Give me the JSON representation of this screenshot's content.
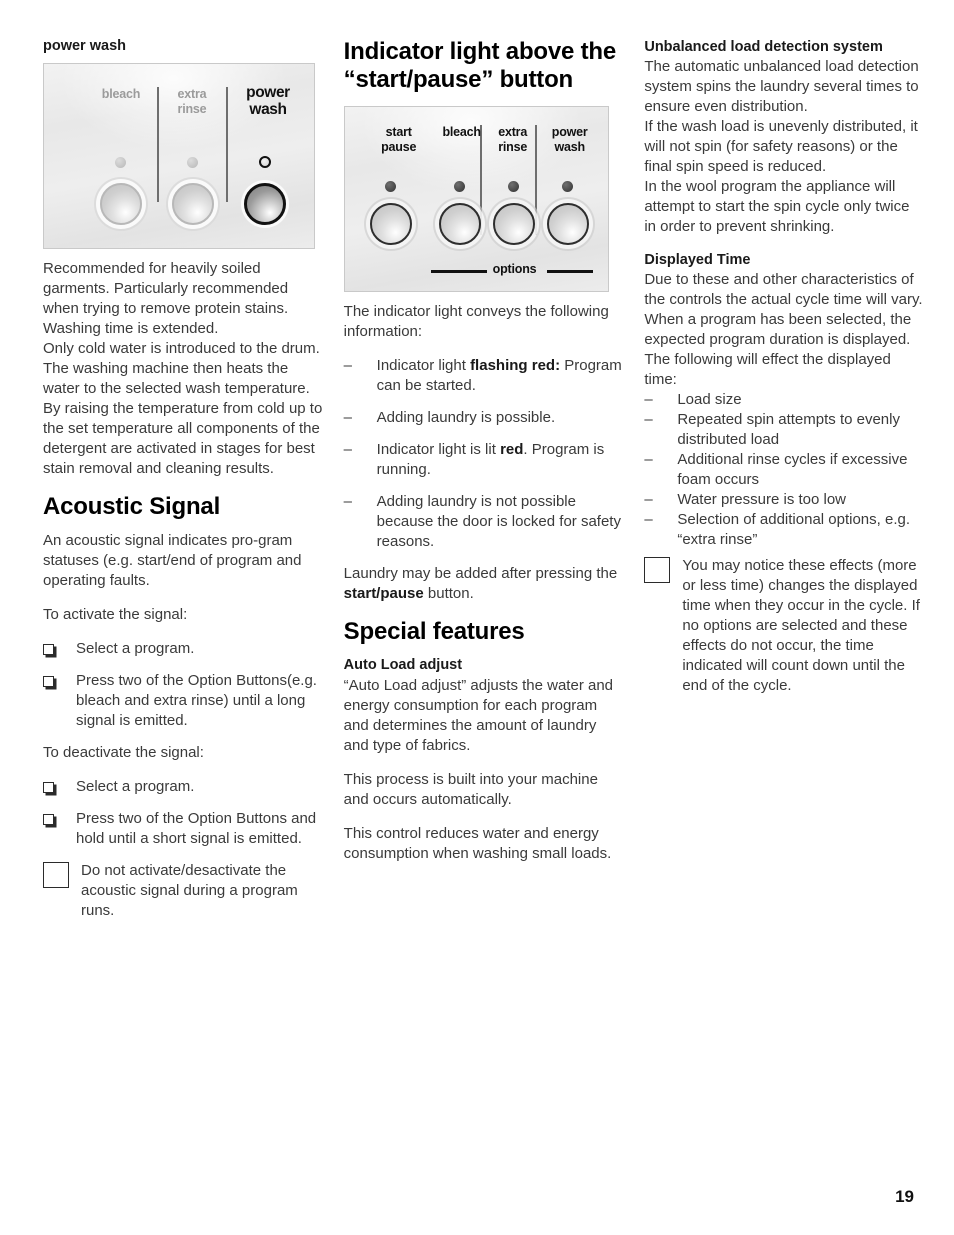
{
  "page": {
    "number": "19"
  },
  "column1": {
    "caption": "power wash",
    "figure": {
      "name": "power-wash-options-panel",
      "labels": [
        {
          "id": "bleach",
          "text": "bleach",
          "state": "dim"
        },
        {
          "id": "extra-rinse",
          "line1": "extra",
          "line2": "rinse",
          "state": "dim"
        },
        {
          "id": "power-wash",
          "line1": "power",
          "line2": "wash",
          "state": "active"
        }
      ]
    },
    "body1": "Recommended for heavily soiled garments. Particularly recommended when trying to remove protein stains.",
    "body2": "Washing time is extended.",
    "body3": "Only cold water is introduced to the drum. The washing machine then heats the water to the selected wash temperature. By raising the temperature  from cold up to the set temperature all components of the detergent are activated in stages for best stain removal and cleaning results.",
    "heading": "Acoustic Signal",
    "intro": "An acoustic signal indicates pro-gram statuses (e.g. start/end of program and operating faults.",
    "activate_label": "To activate the signal:",
    "activate_steps": [
      "Select a program.",
      "Press two of the Option Buttons(e.g. bleach and extra rinse) until a long signal is emitted."
    ],
    "deactivate_label": "To deactivate the signal:",
    "deactivate_steps": [
      "Select a program.",
      "Press two of the Option Buttons and hold until a short signal is emitted."
    ],
    "note": "Do not activate/desactivate the acoustic signal during a program runs."
  },
  "column2": {
    "heading": "Indicator light above the “start/pause” button",
    "figure": {
      "name": "start-pause-options-panel",
      "labels": [
        {
          "id": "start-pause",
          "line1": "start",
          "line2": "pause"
        },
        {
          "id": "bleach",
          "line1": "bleach",
          "line2": ""
        },
        {
          "id": "extra-rinse",
          "line1": "extra",
          "line2": "rinse"
        },
        {
          "id": "power-wash",
          "line1": "power",
          "line2": "wash"
        }
      ],
      "options_label": "options"
    },
    "intro": "The indicator light conveys the following information:",
    "bullets": [
      {
        "lead": "Indicator light ",
        "bold": "flashing red:",
        "rest": " Program can be started."
      },
      {
        "lead": "Adding laundry is possible.",
        "bold": "",
        "rest": ""
      },
      {
        "lead": "Indicator light is lit ",
        "bold": "red",
        "rest": ". Program is running."
      },
      {
        "lead": "Adding laundry is not possible because the door is locked for safety reasons.",
        "bold": "",
        "rest": ""
      }
    ],
    "closing_lead": "Laundry may be added after pressing the ",
    "closing_bold": "start/pause",
    "closing_rest": " button.",
    "heading2": "Special features",
    "sub1": "Auto Load adjust",
    "sub1_body": "“Auto Load adjust” adjusts the water and energy consumption for each program and determines the amount of laundry and type of fabrics.",
    "sub1_body2": "This process is built into your machine and occurs automatically.",
    "sub1_body3": "This control reduces water and energy consumption when washing small loads."
  },
  "column3": {
    "sub1": "Unbalanced load detection system",
    "sub1_body": "The automatic unbalanced load detection system spins the laundry several times to ensure even distribution.",
    "sub1_body2": "If the wash load is unevenly distributed, it will not spin (for safety reasons) or the final spin speed is reduced.",
    "sub1_body3": "In the wool program the appliance will attempt to start the spin cycle only twice in order to prevent shrinking.",
    "sub2": "Displayed Time",
    "sub2_body": "Due to these and other characteristics of the controls the actual cycle time will vary.",
    "sub2_body2": "When a program has been selected, the expected program duration is displayed.",
    "sub2_body3": "The following will effect the displayed time:",
    "bullets": [
      "Load size",
      "Repeated spin attempts to evenly distributed load",
      "Additional rinse cycles if excessive foam occurs",
      "Water pressure is too low",
      "Selection of additional options, e.g. “extra rinse”"
    ],
    "note": "You may notice these effects (more or less time) changes the displayed time when they occur in the cycle. If no options are selected and these effects do not occur, the time indicated will count down until the end of the cycle."
  },
  "markers": {
    "dash": "–"
  }
}
